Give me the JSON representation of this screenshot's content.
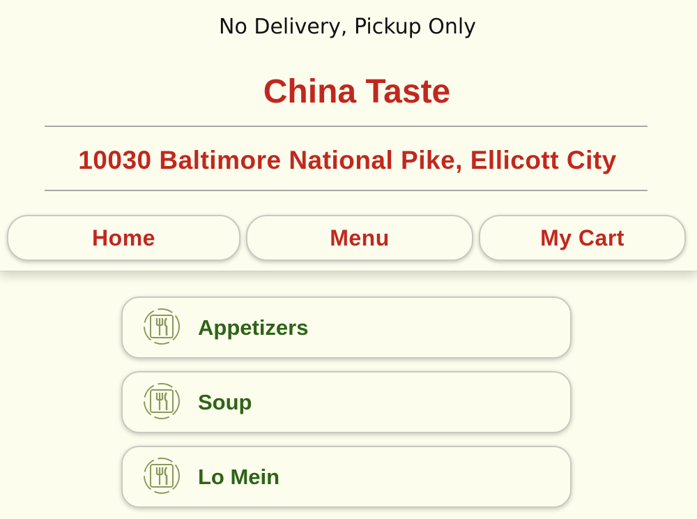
{
  "header": {
    "notice": "No Delivery, Pickup Only",
    "restaurant_name": "China Taste",
    "address": "10030 Baltimore National Pike, Ellicott City"
  },
  "nav": {
    "home_label": "Home",
    "menu_label": "Menu",
    "cart_label": "My Cart"
  },
  "categories": [
    {
      "label": "Appetizers",
      "icon": "utensils-icon"
    },
    {
      "label": "Soup",
      "icon": "utensils-icon"
    },
    {
      "label": "Lo Mein",
      "icon": "utensils-icon"
    }
  ],
  "colors": {
    "background": "#fdfdee",
    "brand_red": "#c0281e",
    "category_green": "#2e6416",
    "icon_olive": "#8a9a5b"
  }
}
